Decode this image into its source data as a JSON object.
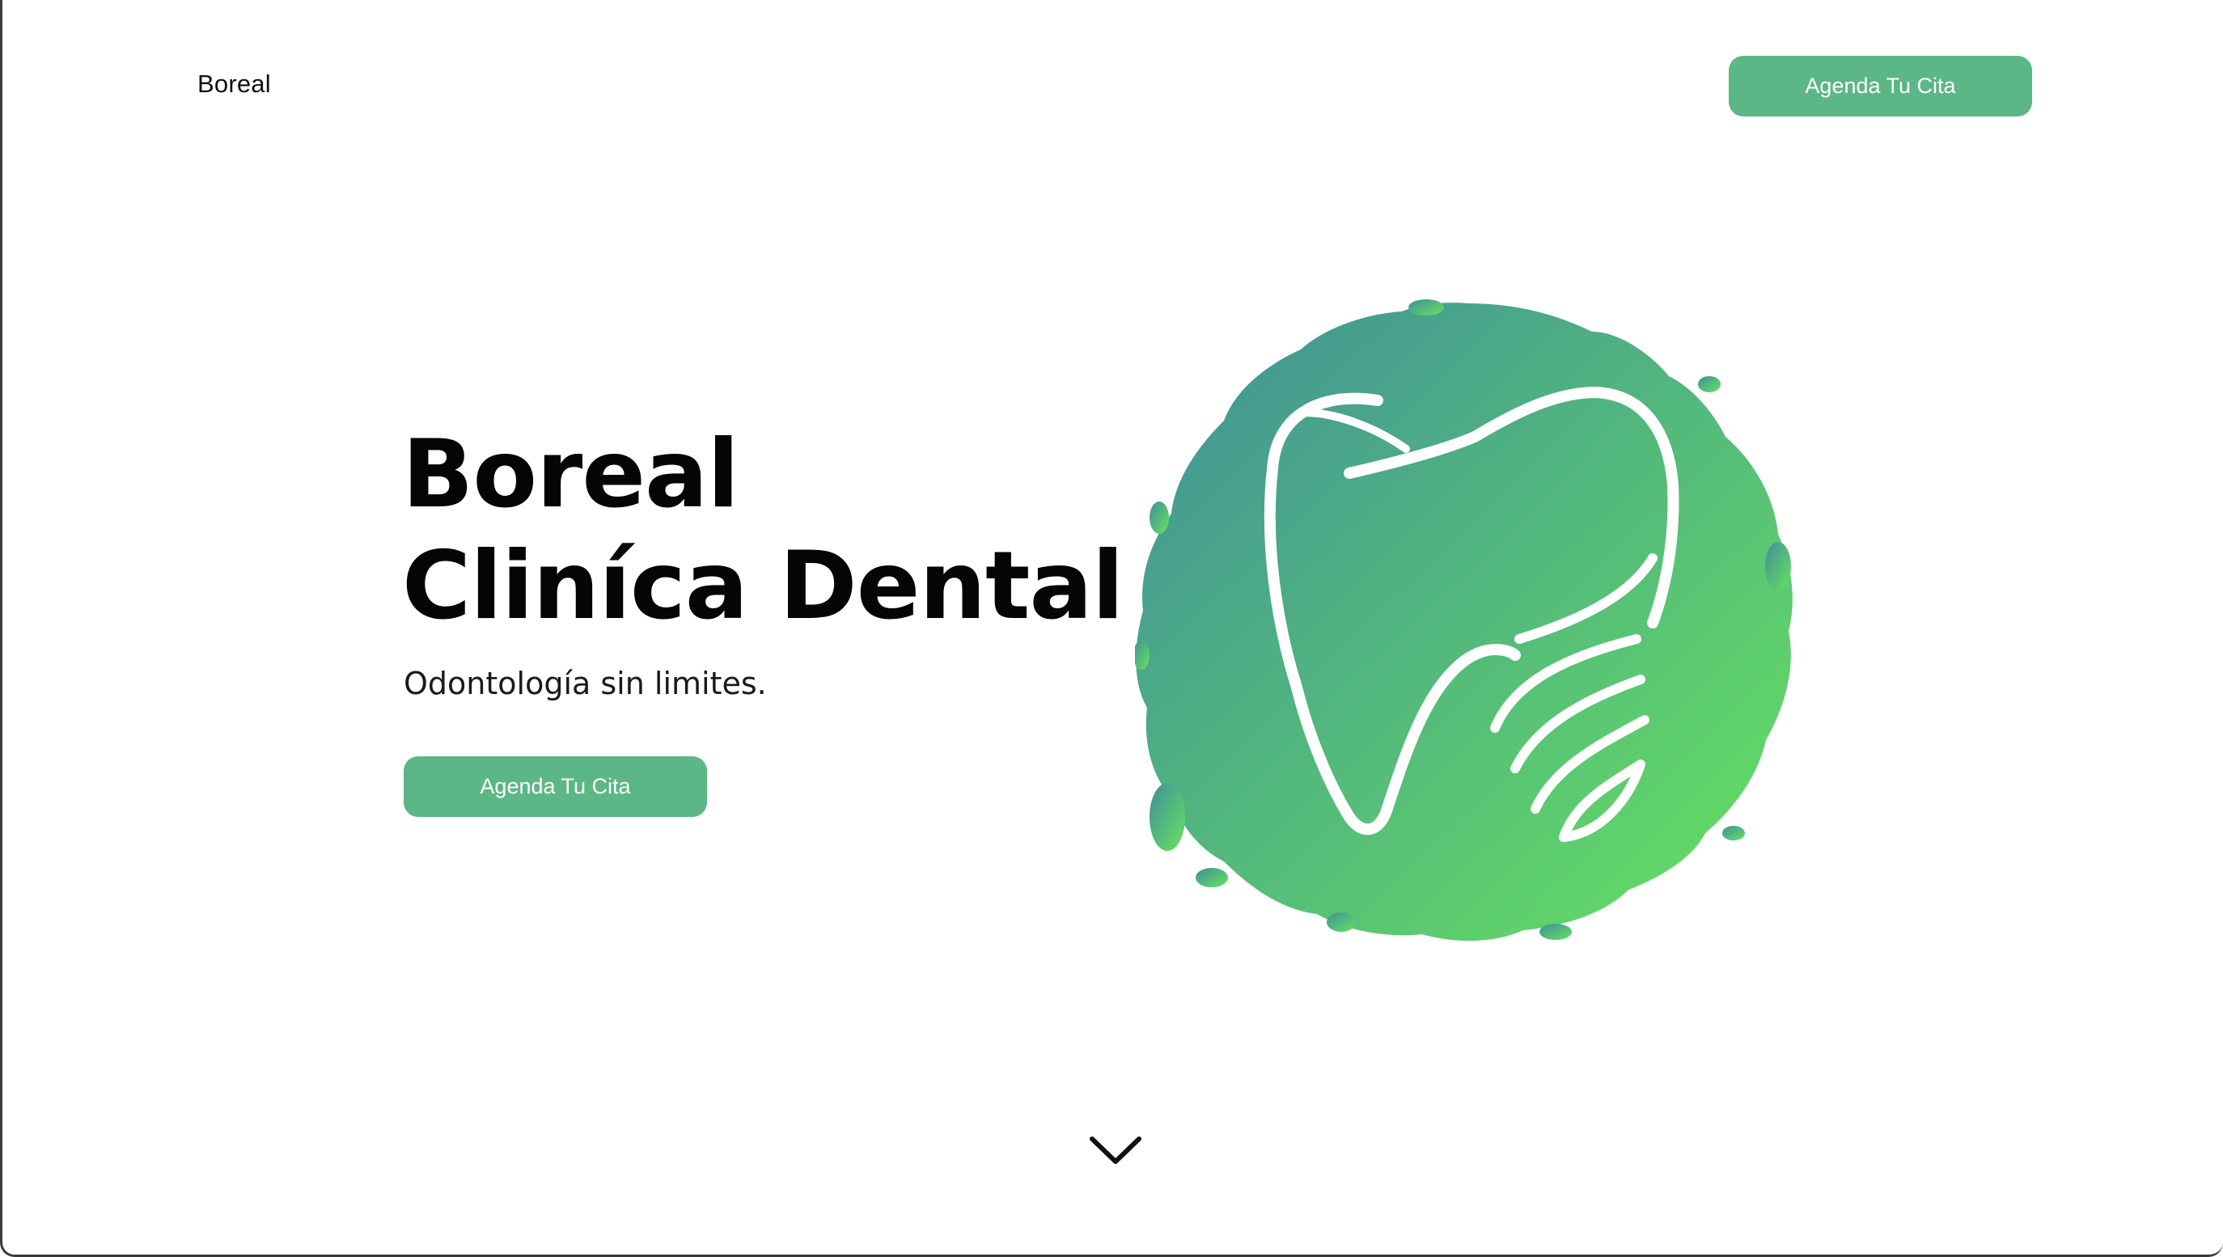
{
  "header": {
    "brand": "Boreal",
    "cta_label": "Agenda Tu Cita"
  },
  "hero": {
    "title_line1": "Boreal",
    "title_line2": "Cliníca Dental",
    "subtitle": "Odontología sin limites.",
    "cta_label": "Agenda Tu Cita"
  },
  "logo": {
    "icon": "tooth-icon",
    "gradient_start": "#3f8f9a",
    "gradient_end": "#67e25f"
  },
  "scroll": {
    "icon": "chevron-down-icon"
  },
  "colors": {
    "accent": "#5cb786",
    "text": "#050505",
    "background": "#ffffff"
  }
}
